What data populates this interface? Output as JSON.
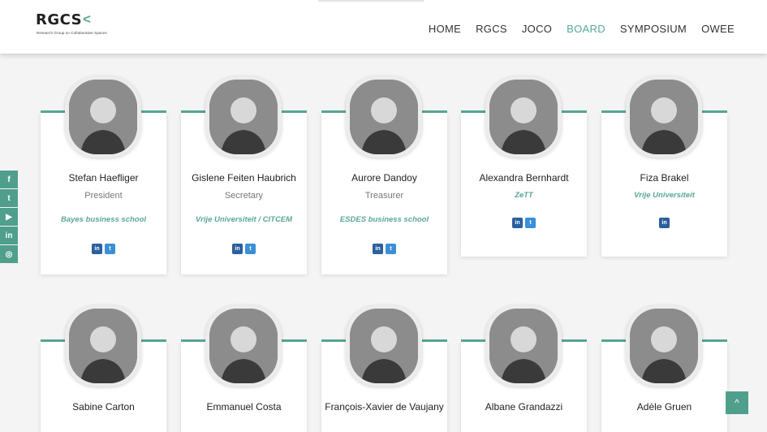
{
  "logo": {
    "text": "RGCS",
    "chevron": "<",
    "subtitle": "Research Group on Collaborative Spaces"
  },
  "nav": [
    "HOME",
    "RGCS",
    "JOCO",
    "BOARD",
    "SYMPOSIUM",
    "OWEE"
  ],
  "nav_active": "BOARD",
  "social_sidebar": [
    {
      "icon": "facebook-icon",
      "glyph": "f"
    },
    {
      "icon": "twitter-icon",
      "glyph": "t"
    },
    {
      "icon": "youtube-icon",
      "glyph": "▶"
    },
    {
      "icon": "linkedin-icon",
      "glyph": "in"
    },
    {
      "icon": "instagram-icon",
      "glyph": "◎"
    }
  ],
  "members_row1": [
    {
      "name": "Stefan Haefliger",
      "role": "President",
      "org": "Bayes business school",
      "links": [
        "linkedin",
        "twitter"
      ]
    },
    {
      "name": "Gislene Feiten Haubrich",
      "role": "Secretary",
      "org": "Vrije Universiteit / CITCEM",
      "links": [
        "linkedin",
        "twitter"
      ]
    },
    {
      "name": "Aurore Dandoy",
      "role": "Treasurer",
      "org": "ESDES business school",
      "links": [
        "linkedin",
        "twitter"
      ]
    },
    {
      "name": "Alexandra Bernhardt",
      "role": "",
      "org": "ZeTT",
      "links": [
        "linkedin",
        "twitter"
      ]
    },
    {
      "name": "Fiza Brakel",
      "role": "",
      "org": "Vrije Universiteit",
      "links": [
        "linkedin"
      ]
    }
  ],
  "members_row2": [
    {
      "name": "Sabine Carton"
    },
    {
      "name": "Emmanuel Costa"
    },
    {
      "name": "François-Xavier de Vaujany"
    },
    {
      "name": "Albane Grandazzi"
    },
    {
      "name": "Adèle Gruen"
    }
  ],
  "colors": {
    "accent": "#5aa897",
    "linkedin": "#2c5f9e",
    "twitter": "#3b8fd6"
  },
  "scroll_top": {
    "icon": "chevron-up-icon",
    "glyph": "^"
  }
}
